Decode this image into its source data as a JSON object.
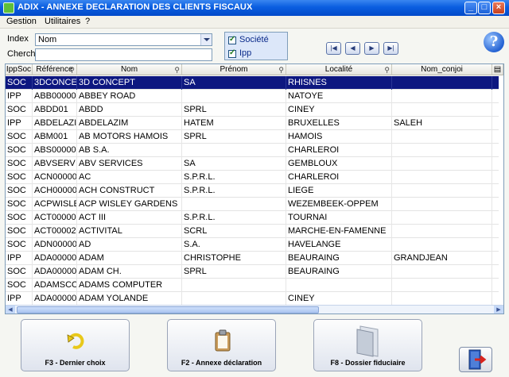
{
  "window": {
    "title": "ADIX - ANNEXE DECLARATION DES CLIENTS FISCAUX"
  },
  "menu": [
    "Gestion",
    "Utilitaires",
    "?"
  ],
  "filters": {
    "index_label": "Index",
    "index_value": "Nom",
    "search_label": "Cherche",
    "search_value": "",
    "checkboxes": [
      {
        "label": "Société",
        "checked": true
      },
      {
        "label": "Ipp",
        "checked": true
      }
    ]
  },
  "grid": {
    "columns": [
      "IppSoc",
      "Référence",
      "Nom",
      "Prénom",
      "Localité",
      "Nom_conjoi"
    ],
    "selected_row": 0,
    "rows": [
      [
        "SOC",
        "3DCONCE",
        "3D CONCEPT",
        "SA",
        "RHISNES",
        ""
      ],
      [
        "IPP",
        "ABB00000",
        "ABBEY ROAD",
        "",
        "NATOYE",
        ""
      ],
      [
        "SOC",
        "ABDD01",
        "ABDD",
        "SPRL",
        "CINEY",
        ""
      ],
      [
        "IPP",
        "ABDELAZI",
        "ABDELAZIM",
        "HATEM",
        "BRUXELLES",
        "SALEH"
      ],
      [
        "SOC",
        "ABM001",
        "AB MOTORS HAMOIS",
        "SPRL",
        "HAMOIS",
        ""
      ],
      [
        "SOC",
        "ABS00000",
        "AB S.A.",
        "",
        "CHARLEROI",
        ""
      ],
      [
        "SOC",
        "ABVSERV",
        "ABV SERVICES",
        "SA",
        "GEMBLOUX",
        ""
      ],
      [
        "SOC",
        "ACN00000",
        "AC",
        "S.P.R.L.",
        "CHARLEROI",
        ""
      ],
      [
        "SOC",
        "ACH00000",
        "ACH CONSTRUCT",
        "S.P.R.L.",
        "LIEGE",
        ""
      ],
      [
        "SOC",
        "ACPWISLE",
        "ACP WISLEY GARDENS",
        "",
        "WEZEMBEEK-OPPEM",
        ""
      ],
      [
        "SOC",
        "ACT00000",
        "ACT III",
        "S.P.R.L.",
        "TOURNAI",
        ""
      ],
      [
        "SOC",
        "ACT00002",
        "ACTIVITAL",
        "SCRL",
        "MARCHE-EN-FAMENNE",
        ""
      ],
      [
        "SOC",
        "ADN00000",
        "AD",
        "S.A.",
        "HAVELANGE",
        ""
      ],
      [
        "IPP",
        "ADA00000",
        "ADAM",
        "CHRISTOPHE",
        "BEAURAING",
        "GRANDJEAN"
      ],
      [
        "SOC",
        "ADA00000",
        "ADAM CH.",
        "SPRL",
        "BEAURAING",
        ""
      ],
      [
        "SOC",
        "ADAMSCO",
        "ADAMS COMPUTER",
        "",
        "",
        ""
      ],
      [
        "IPP",
        "ADA00000",
        "ADAM YOLANDE",
        "",
        "CINEY",
        ""
      ]
    ]
  },
  "buttons": {
    "f3": "F3 - Dernier choix",
    "f2": "F2 - Annexe déclaration",
    "f8": "F8 - Dossier fiduciaire"
  },
  "colors": {
    "title_bar": "#0a5ee0",
    "selection": "#0d1780"
  }
}
